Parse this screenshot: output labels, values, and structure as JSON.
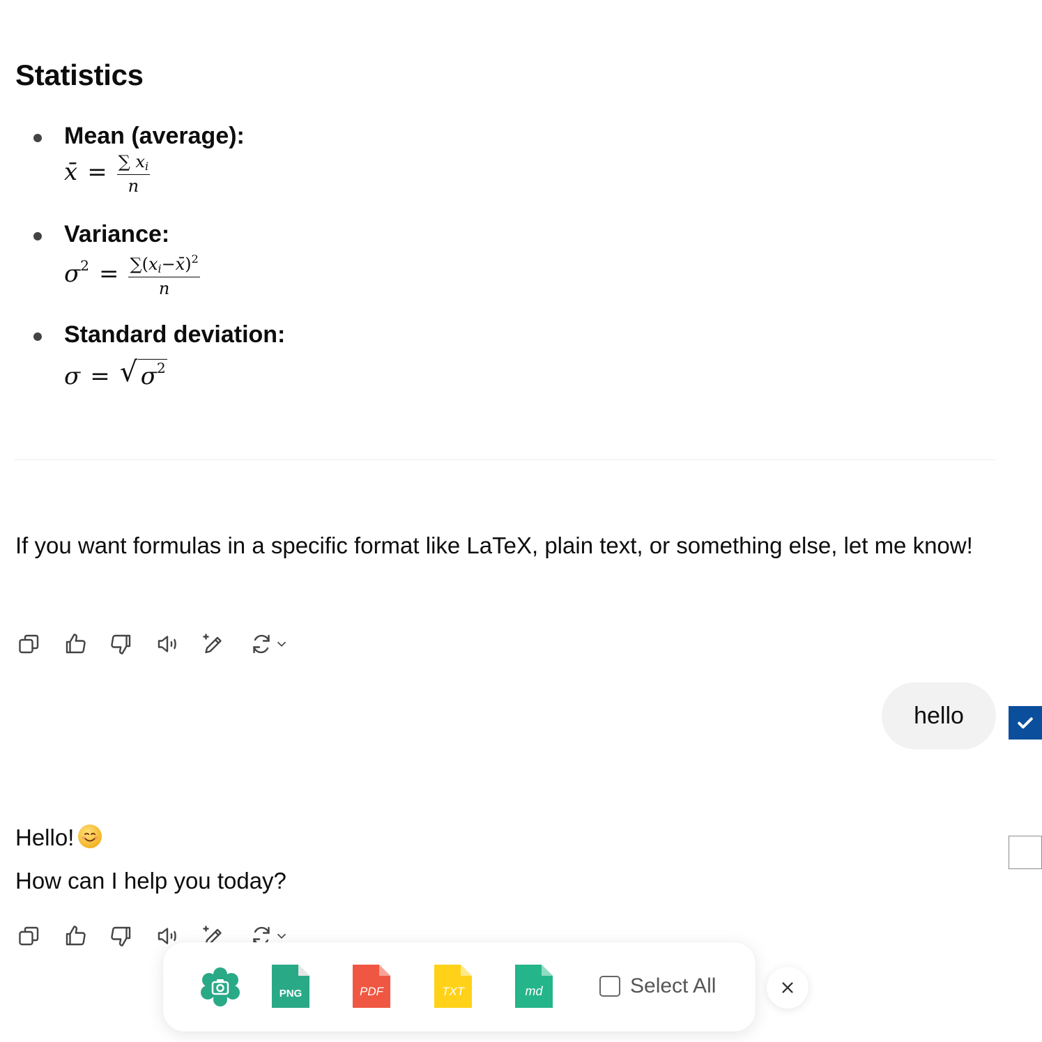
{
  "statistics": {
    "title": "Statistics",
    "items": [
      {
        "label": "Mean (average):",
        "formula": "x̄ = ∑xᵢ / n"
      },
      {
        "label": "Variance:",
        "formula": "σ² = ∑(xᵢ − x̄)² / n"
      },
      {
        "label": "Standard deviation:",
        "formula": "σ = √σ²"
      }
    ]
  },
  "math": {
    "xbar": "x̄",
    "sigma": "σ",
    "sum": "∑",
    "x": "x",
    "i": "i",
    "n": "n",
    "two": "2",
    "eq": "=",
    "minus": "−",
    "open": "(",
    "close": ")",
    "sqrt": "√"
  },
  "messages": {
    "assistant_1": "If you want formulas in a specific format like LaTeX, plain text, or something else, let me know!",
    "user_1": "hello",
    "assistant_2_line1": "Hello!",
    "assistant_2_line2": "How can I help you today?"
  },
  "action_icons": [
    "copy-icon",
    "thumbs-up-icon",
    "thumbs-down-icon",
    "speaker-icon",
    "edit-icon",
    "regenerate-icon",
    "chevron-down-icon"
  ],
  "export_toolbar": {
    "screenshot_icon": "camera-icon",
    "formats": [
      {
        "label": "PNG",
        "color": "#2aa987"
      },
      {
        "label": "PDF",
        "color": "#f05742"
      },
      {
        "label": "TXT",
        "color": "#ffd219"
      },
      {
        "label": "md",
        "color": "#25b58a"
      }
    ],
    "select_all_label": "Select All",
    "close_icon": "close-icon"
  },
  "colors": {
    "checkbox_checked": "#0b4f9c",
    "user_bubble": "#f2f2f2",
    "screenshot_green": "#2aa987"
  }
}
